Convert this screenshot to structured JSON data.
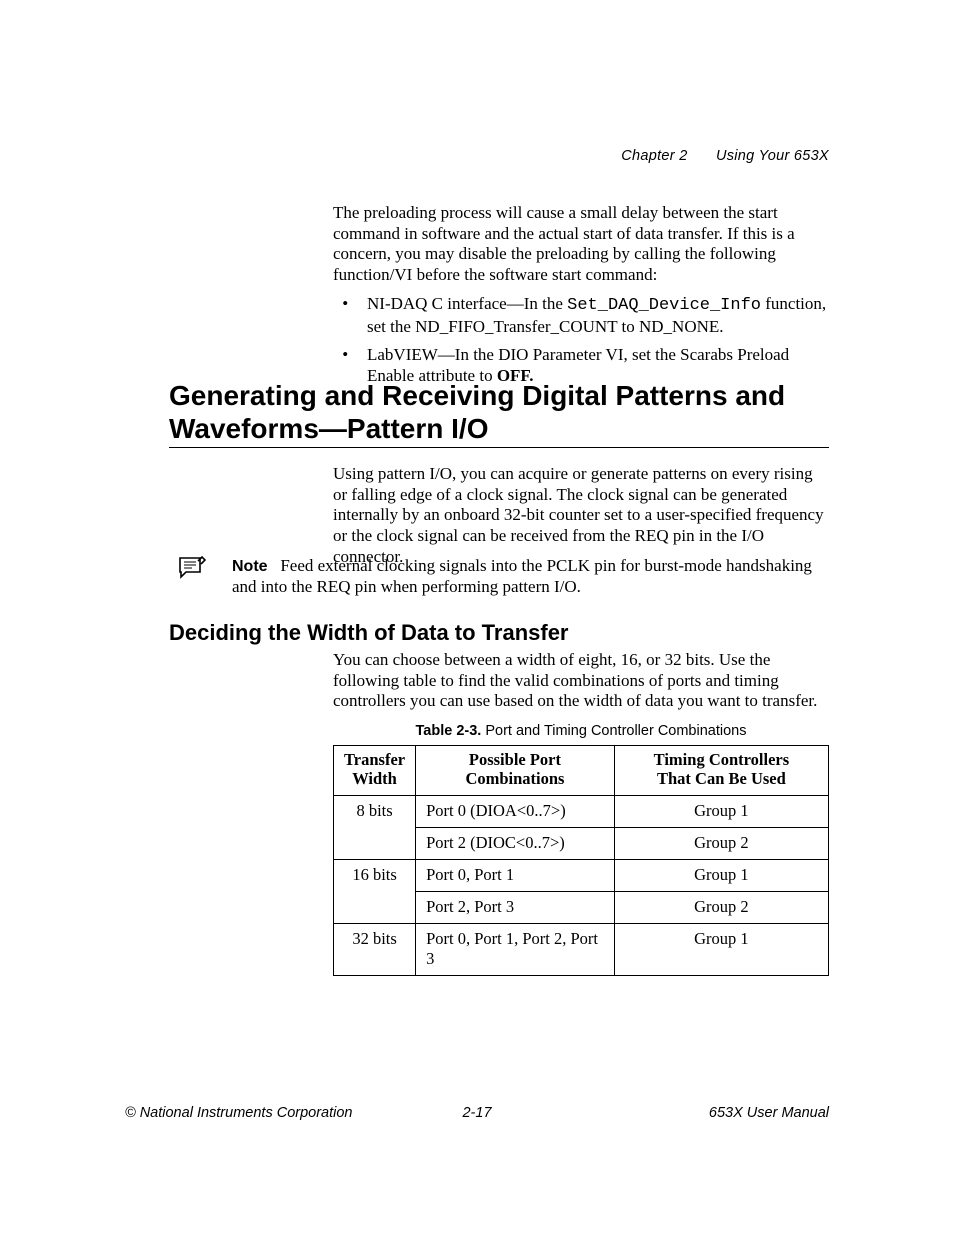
{
  "header": {
    "chapter": "Chapter 2",
    "title": "Using Your 653X"
  },
  "para1": {
    "text": "The preloading process will cause a small delay between the start command in software and the actual start of data transfer. If this is a concern, you may disable the preloading by calling the following function/VI before the software start command:"
  },
  "bullets": {
    "b1a": "NI-DAQ C interface—In the ",
    "b1code": "Set_DAQ_Device_Info",
    "b1b": " function, set the ND_FIFO_Transfer_COUNT to ND_NONE.",
    "b2a": "LabVIEW—In the DIO Parameter VI, set the Scarabs Preload Enable attribute to ",
    "b2bold": "OFF."
  },
  "h1": {
    "line1": "Generating and Receiving Digital Patterns and",
    "line2": "Waveforms—Pattern I/O"
  },
  "para2": {
    "text": "Using pattern I/O, you can acquire or generate patterns on every rising or falling edge of a clock signal. The clock signal can be generated internally by an onboard 32-bit counter set to a user-specified frequency or the clock signal can be received from the REQ pin in the I/O connector."
  },
  "note": {
    "label": "Note",
    "text": "Feed external clocking signals into the PCLK pin for burst-mode handshaking and into the REQ pin when performing pattern I/O."
  },
  "h2": "Deciding the Width of Data to Transfer",
  "para3": {
    "text": "You can choose between a width of eight, 16, or 32 bits. Use the following table to find the valid combinations of ports and timing controllers you can use based on the width of data you want to transfer."
  },
  "tableCaption": {
    "label": "Table 2-3.",
    "title": "Port and Timing Controller Combinations"
  },
  "table": {
    "head": {
      "c1a": "Transfer",
      "c1b": "Width",
      "c2a": "Possible Port",
      "c2b": "Combinations",
      "c3a": "Timing Controllers",
      "c3b": "That Can Be Used"
    },
    "rows": [
      {
        "c1": "8 bits",
        "c2": "Port 0 (DIOA<0..7>)",
        "c3": "Group 1"
      },
      {
        "c1": "",
        "c2": "Port 2 (DIOC<0..7>)",
        "c3": "Group 2"
      },
      {
        "c1": "16 bits",
        "c2": "Port 0, Port 1",
        "c3": "Group 1"
      },
      {
        "c1": "",
        "c2": "Port 2, Port 3",
        "c3": "Group 2"
      },
      {
        "c1": "32 bits",
        "c2": "Port 0, Port 1, Port 2, Port 3",
        "c3": "Group 1"
      }
    ]
  },
  "footer": {
    "left": "© National Instruments Corporation",
    "center": "2-17",
    "right": "653X User Manual"
  }
}
